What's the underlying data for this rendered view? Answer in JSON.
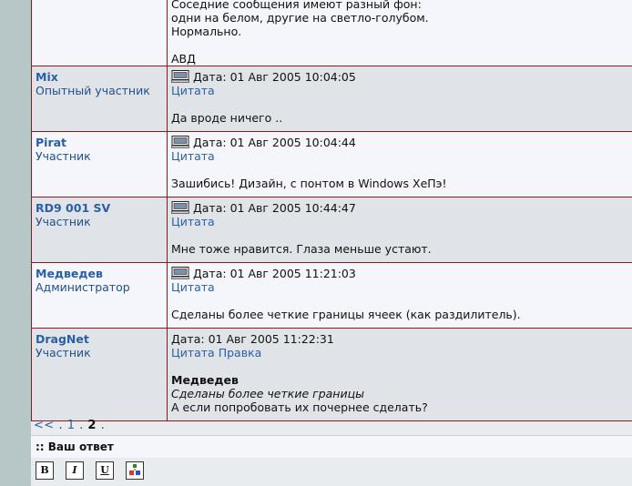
{
  "first_post_tail": {
    "lines": [
      "Соседние сообщения имеют разный фон:",
      "одни на белом, другие на светло-голубом.",
      "Нормально.",
      "",
      "АВД"
    ]
  },
  "posts": [
    {
      "username": "Mix",
      "rank": "Опытный участник",
      "date_label": "Дата:",
      "date": "01 Авг 2005 10:04:05",
      "actions": [
        "Цитата"
      ],
      "body_lines": [
        "Да вроде ничего .."
      ],
      "icon": "pc-icon"
    },
    {
      "username": "Pirat",
      "rank": "Участник",
      "date_label": "Дата:",
      "date": "01 Авг 2005 10:04:44",
      "actions": [
        "Цитата"
      ],
      "body_lines": [
        "Зашибись! Дизайн, с понтом в Windows ХеПэ!"
      ],
      "icon": "pc-icon"
    },
    {
      "username": "RD9 001 SV",
      "rank": "Участник",
      "date_label": "Дата:",
      "date": "01 Авг 2005 10:44:47",
      "actions": [
        "Цитата"
      ],
      "body_lines": [
        "Мне тоже нравится. Глаза меньше устают."
      ],
      "icon": "pc-icon"
    },
    {
      "username": "Медведев",
      "rank": "Администратор",
      "date_label": "Дата:",
      "date": "01 Авг 2005 11:21:03",
      "actions": [
        "Цитата"
      ],
      "body_lines": [
        "Сделаны более четкие границы ячеек (как раздилитель)."
      ],
      "icon": "pc-icon"
    },
    {
      "username": "DragNet",
      "rank": "Участник",
      "date_label": "Дата:",
      "date": "01 Авг 2005 11:22:31",
      "actions": [
        "Цитата",
        "Правка"
      ],
      "quote_author": "Медведев",
      "quote_text": "Сделаны более четкие границы",
      "body_lines": [
        "А если попробовать их почернее сделать?"
      ]
    }
  ],
  "pager": {
    "prev": "<<",
    "sep": ".",
    "pages": [
      "1",
      "2"
    ],
    "current": "2"
  },
  "reply": {
    "header": ":: Ваш ответ"
  },
  "toolbar": {
    "bold": "B",
    "italic": "I",
    "underline": "U",
    "image_icon": "image-insert-icon"
  },
  "colors": {
    "border": "#8b1a1a",
    "link": "#2a5fa6",
    "username": "#1f4f8c",
    "row_light": "#f4f6fb",
    "row_dark": "#e0e4e8"
  }
}
